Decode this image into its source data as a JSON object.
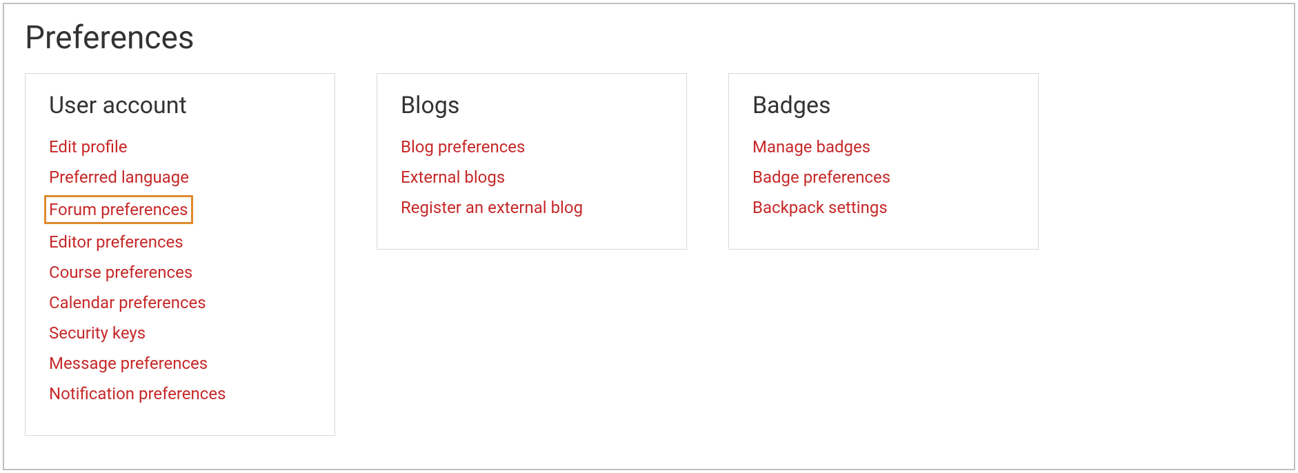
{
  "page": {
    "title": "Preferences"
  },
  "sections": [
    {
      "title": "User account",
      "links": [
        {
          "label": "Edit profile",
          "highlighted": false
        },
        {
          "label": "Preferred language",
          "highlighted": false
        },
        {
          "label": "Forum preferences",
          "highlighted": true
        },
        {
          "label": "Editor preferences",
          "highlighted": false
        },
        {
          "label": "Course preferences",
          "highlighted": false
        },
        {
          "label": "Calendar preferences",
          "highlighted": false
        },
        {
          "label": "Security keys",
          "highlighted": false
        },
        {
          "label": "Message preferences",
          "highlighted": false
        },
        {
          "label": "Notification preferences",
          "highlighted": false
        }
      ]
    },
    {
      "title": "Blogs",
      "links": [
        {
          "label": "Blog preferences",
          "highlighted": false
        },
        {
          "label": "External blogs",
          "highlighted": false
        },
        {
          "label": "Register an external blog",
          "highlighted": false
        }
      ]
    },
    {
      "title": "Badges",
      "links": [
        {
          "label": "Manage badges",
          "highlighted": false
        },
        {
          "label": "Badge preferences",
          "highlighted": false
        },
        {
          "label": "Backpack settings",
          "highlighted": false
        }
      ]
    }
  ]
}
